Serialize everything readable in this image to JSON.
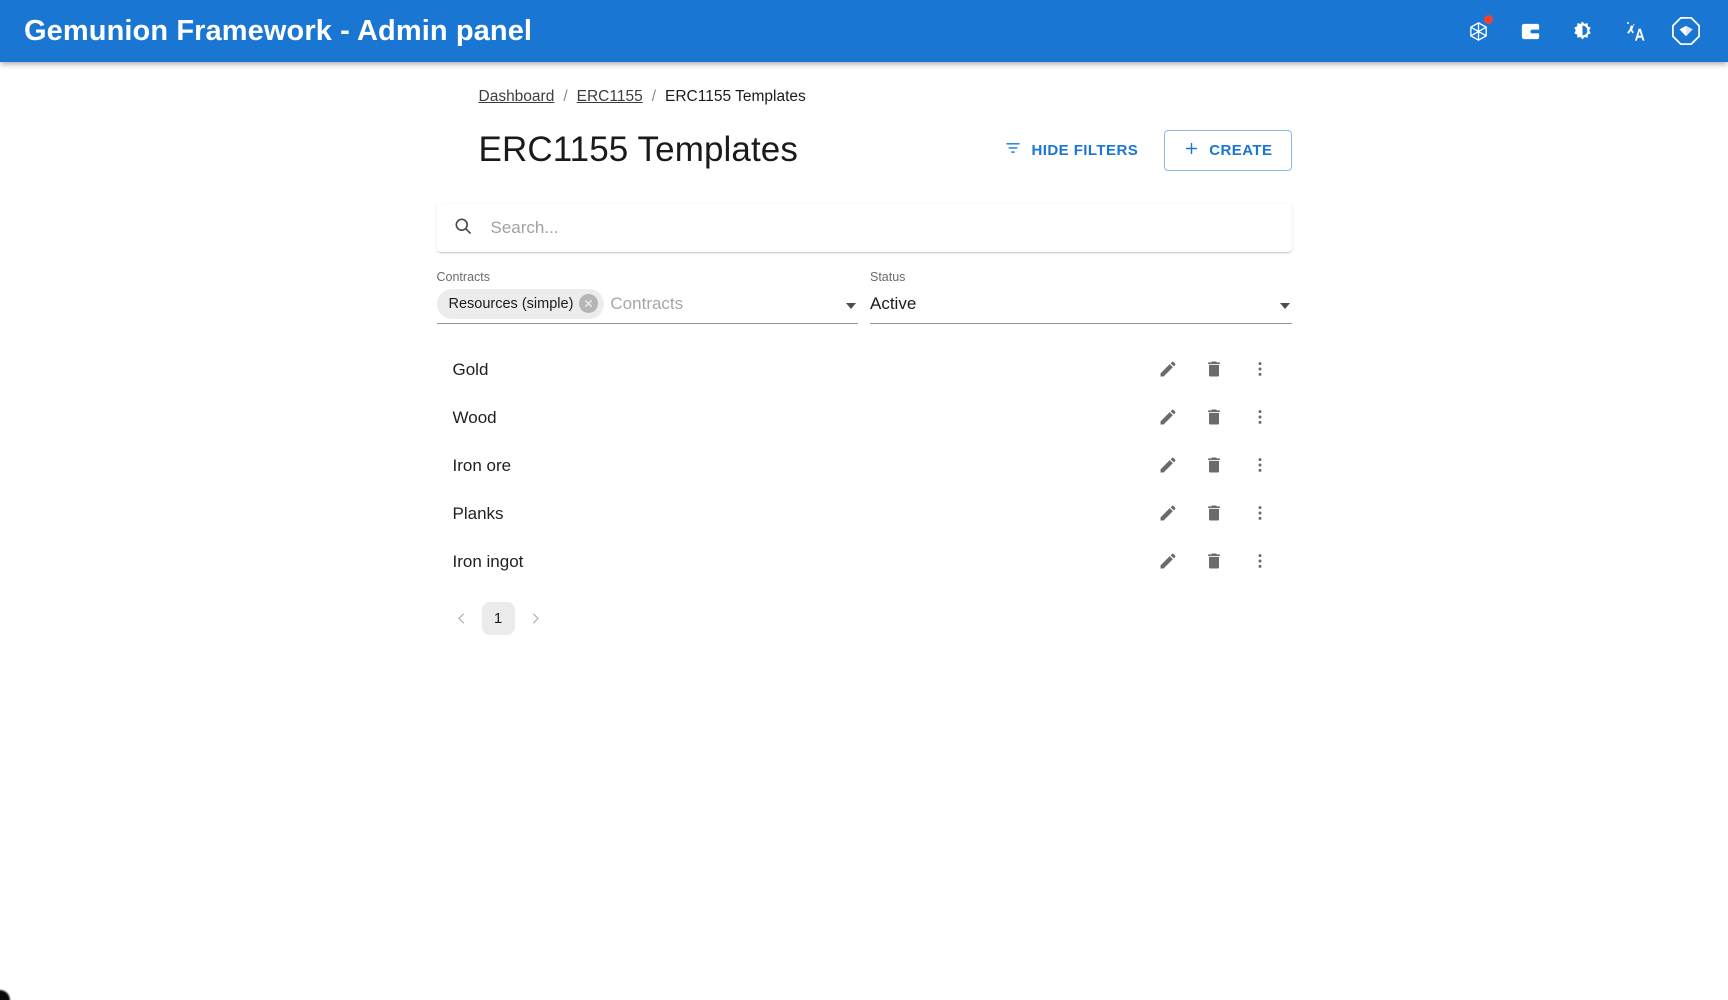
{
  "appbar": {
    "title": "Gemunion Framework - Admin panel",
    "background": "#1976d2",
    "actions": [
      {
        "name": "ethereum-network-icon",
        "label": "",
        "badge": true
      },
      {
        "name": "wallet-icon",
        "label": "",
        "badge": false
      },
      {
        "name": "theme-toggle-icon",
        "label": "",
        "badge": false
      },
      {
        "name": "language-icon",
        "label": "",
        "badge": false
      },
      {
        "name": "profile-logo-icon",
        "label": "",
        "badge": false
      }
    ]
  },
  "breadcrumb": {
    "separator": "/",
    "items": [
      {
        "label": "Dashboard",
        "link": true
      },
      {
        "label": "ERC1155",
        "link": true
      },
      {
        "label": "ERC1155 Templates",
        "link": false
      }
    ]
  },
  "header": {
    "title": "ERC1155 Templates",
    "hide_filters_label": "HIDE FILTERS",
    "create_label": "CREATE",
    "accent": "#1976d2"
  },
  "search": {
    "placeholder": "Search...",
    "value": ""
  },
  "filters": {
    "contracts": {
      "label": "Contracts",
      "placeholder": "Contracts",
      "chips": [
        {
          "label": "Resources (simple)"
        }
      ]
    },
    "status": {
      "label": "Status",
      "value": "Active"
    }
  },
  "list": {
    "rows": [
      {
        "label": "Gold"
      },
      {
        "label": "Wood"
      },
      {
        "label": "Iron ore"
      },
      {
        "label": "Planks"
      },
      {
        "label": "Iron ingot"
      }
    ],
    "row_actions": [
      {
        "name": "edit-icon",
        "title": "Edit"
      },
      {
        "name": "delete-icon",
        "title": "Delete"
      },
      {
        "name": "more-vert-icon",
        "title": "More"
      }
    ]
  },
  "pagination": {
    "prev_label": "‹",
    "next_label": "›",
    "pages": [
      "1"
    ],
    "current": "1"
  }
}
